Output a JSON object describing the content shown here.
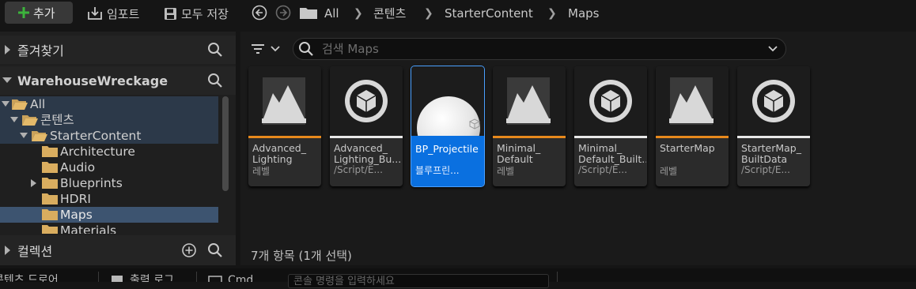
{
  "toolbar": {
    "add_label": "추가",
    "import_label": "임포트",
    "save_all_label": "모두 저장",
    "breadcrumbs": [
      "All",
      "콘텐츠",
      "StarterContent",
      "Maps"
    ]
  },
  "favorites": {
    "label": "즐겨찾기"
  },
  "project": {
    "label": "WarehouseWreckage"
  },
  "tree": [
    {
      "label": "All"
    },
    {
      "label": "콘텐츠"
    },
    {
      "label": "StarterContent"
    },
    {
      "label": "Architecture"
    },
    {
      "label": "Audio"
    },
    {
      "label": "Blueprints"
    },
    {
      "label": "HDRI"
    },
    {
      "label": "Maps"
    },
    {
      "label": "Materials"
    }
  ],
  "collections": {
    "label": "컬렉션"
  },
  "search": {
    "placeholder": "검색 Maps"
  },
  "assets": [
    {
      "name": "Advanced_\nLighting",
      "type": "레벨",
      "kind": "level",
      "bar_color": "#e8891c"
    },
    {
      "name": "Advanced_\nLighting_Bu...",
      "type": "/Script/E...",
      "kind": "data",
      "bar_color": "#e8e8e8"
    },
    {
      "name": "BP_Projectile",
      "type": "블루프린...",
      "kind": "blueprint",
      "bar_color": "#0a70e0",
      "selected": true
    },
    {
      "name": "Minimal_\nDefault",
      "type": "레벨",
      "kind": "level",
      "bar_color": "#e8891c"
    },
    {
      "name": "Minimal_\nDefault_Built...",
      "type": "/Script/E...",
      "kind": "data",
      "bar_color": "#e8e8e8"
    },
    {
      "name": "StarterMap",
      "type": "레벨",
      "kind": "level",
      "bar_color": "#e8891c"
    },
    {
      "name": "StarterMap_\nBuiltData",
      "type": "/Script/E...",
      "kind": "data",
      "bar_color": "#e8e8e8"
    }
  ],
  "status": {
    "text": "7개 항목 (1개 선택)"
  },
  "bottom": {
    "content_drawer": "콘텐츠 드로어",
    "output_log": "출력 로그",
    "cmd": "Cmd",
    "console_placeholder": "콘솔 명령을 입력하세요"
  }
}
